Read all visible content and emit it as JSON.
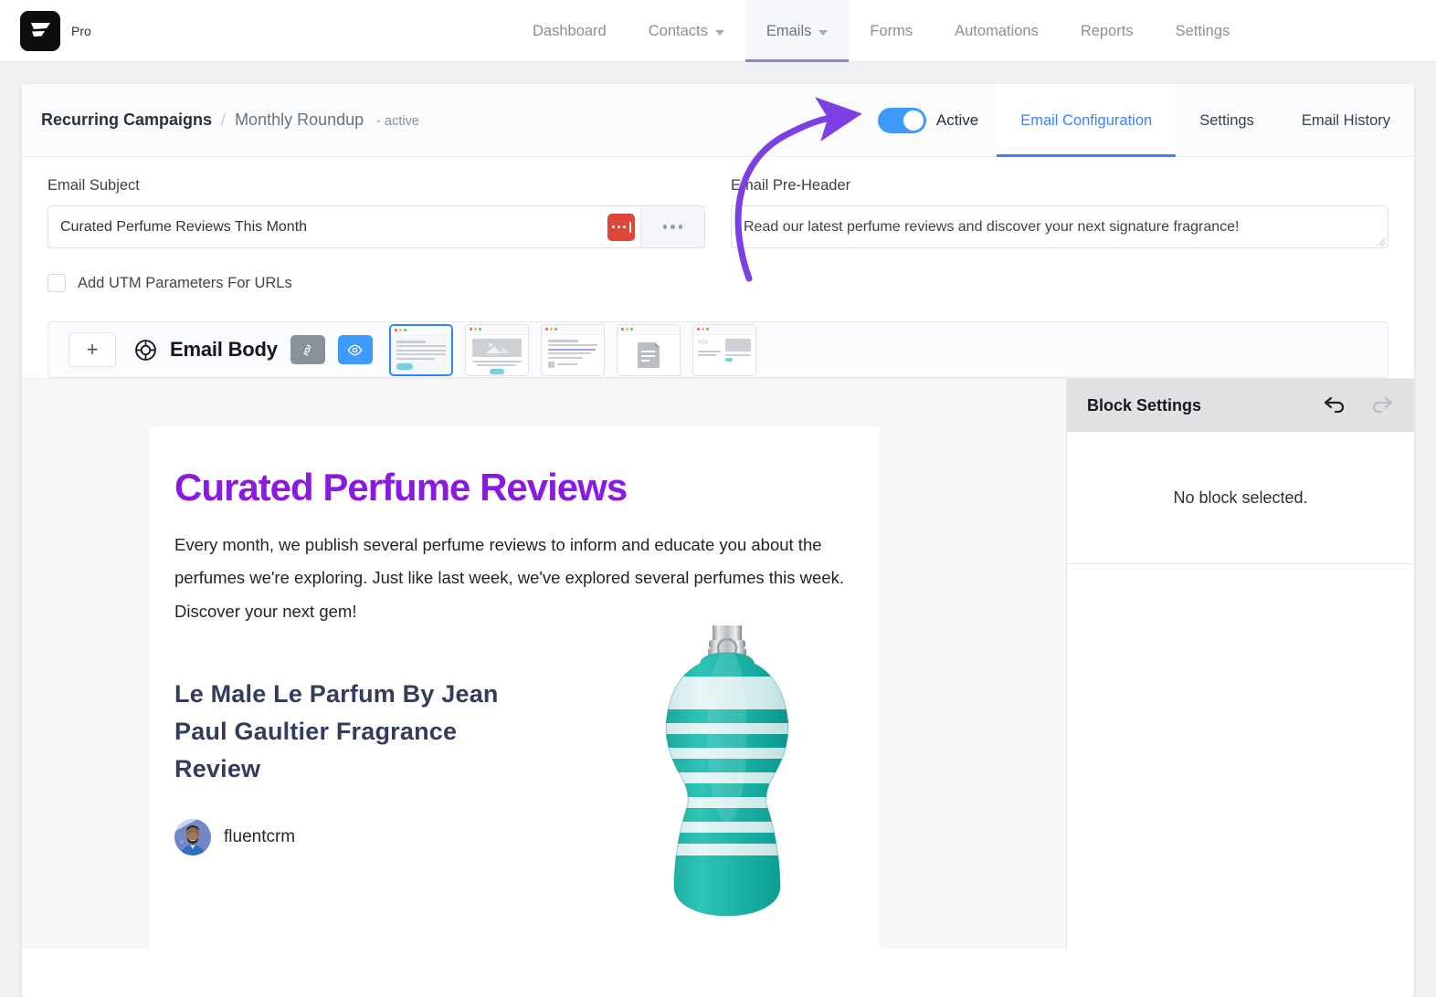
{
  "app": {
    "brand_logo_icon": "fluentcrm-logo-icon",
    "brand_badge": "Pro"
  },
  "nav": {
    "items": [
      {
        "label": "Dashboard",
        "has_chevron": false,
        "active": false
      },
      {
        "label": "Contacts",
        "has_chevron": true,
        "active": false
      },
      {
        "label": "Emails",
        "has_chevron": true,
        "active": true
      },
      {
        "label": "Forms",
        "has_chevron": false,
        "active": false
      },
      {
        "label": "Automations",
        "has_chevron": false,
        "active": false
      },
      {
        "label": "Reports",
        "has_chevron": false,
        "active": false
      },
      {
        "label": "Settings",
        "has_chevron": false,
        "active": false
      }
    ]
  },
  "breadcrumb": {
    "root": "Recurring Campaigns",
    "separator": "/",
    "current": "Monthly Roundup",
    "state": "- active"
  },
  "header_controls": {
    "toggle_on": true,
    "toggle_label": "Active",
    "tabs": [
      {
        "label": "Email Configuration",
        "active": true
      },
      {
        "label": "Settings",
        "active": false
      },
      {
        "label": "Email History",
        "active": false
      }
    ]
  },
  "form": {
    "subject_label": "Email Subject",
    "subject_value": "Curated Perfume Reviews This Month",
    "subject_placeholder": "Email Subject",
    "smarttag_button_icon": "smart-tag-icon",
    "more_button_icon": "ellipsis-icon",
    "preheader_label": "Email Pre-Header",
    "preheader_value": "Read our latest perfume reviews and discover your next signature fragrance!",
    "preheader_placeholder": "Email Pre-Header",
    "utm_checkbox_label": "Add UTM Parameters For URLs",
    "utm_checked": false
  },
  "body_toolbar": {
    "add_button_label": "+",
    "ring_icon": "target-ring-icon",
    "title": "Email Body",
    "gear_icon": "gear-icon",
    "eye_icon": "eye-icon",
    "templates": [
      {
        "name": "text-template",
        "selected": true
      },
      {
        "name": "image-template",
        "selected": false
      },
      {
        "name": "article-template",
        "selected": false
      },
      {
        "name": "document-template",
        "selected": false
      },
      {
        "name": "code-image-template",
        "selected": false
      }
    ]
  },
  "email_preview": {
    "heading": "Curated Perfume Reviews",
    "paragraph": "Every month, we publish several perfume reviews to inform and educate you about the perfumes we're exploring. Just like last week, we've explored several perfumes this week. Discover your next gem!",
    "review_heading": "Le Male Le Parfum By Jean Paul Gaultier Fragrance Review",
    "author_name": "fluentcrm",
    "product_image_alt": "perfume-bottle-image"
  },
  "block_settings": {
    "title": "Block Settings",
    "undo_icon": "undo-icon",
    "redo_icon": "redo-icon",
    "empty_message": "No block selected."
  },
  "annotation": {
    "arrow_color": "#7b3fe4",
    "points_to": "active-toggle"
  },
  "colors": {
    "accent_blue": "#3d7ffc",
    "toggle_blue": "#3d9bfc",
    "heading_purple": "#8b1ae0",
    "red_button": "#df4539",
    "nav_underline": "#8b87d8",
    "review_navy": "#323d5e"
  }
}
